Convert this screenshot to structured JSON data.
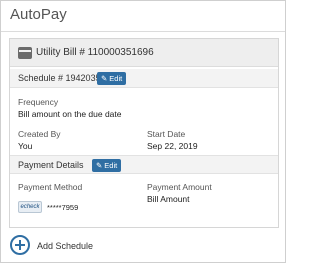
{
  "header": {
    "title": "AutoPay"
  },
  "card": {
    "bill_title": "Utility Bill # 110000351696",
    "schedule_label": "Schedule # 19420354",
    "edit_label": "Edit",
    "frequency_label": "Frequency",
    "frequency_value": "Bill amount on the due date",
    "created_by_label": "Created By",
    "created_by_value": "You",
    "start_date_label": "Start Date",
    "start_date_value": "Sep 22, 2019",
    "payment_details_label": "Payment Details",
    "payment_method_label": "Payment Method",
    "payment_method_badge": "echeck",
    "payment_method_value": "*****7959",
    "payment_amount_label": "Payment Amount",
    "payment_amount_value": "Bill Amount"
  },
  "footer": {
    "add_schedule_label": "Add Schedule"
  },
  "colors": {
    "accent": "#2f6ea3",
    "header_bg": "#eeeeee"
  },
  "icons": {
    "bill": "bill-icon",
    "edit": "pencil-icon",
    "add": "plus-circle-icon"
  }
}
